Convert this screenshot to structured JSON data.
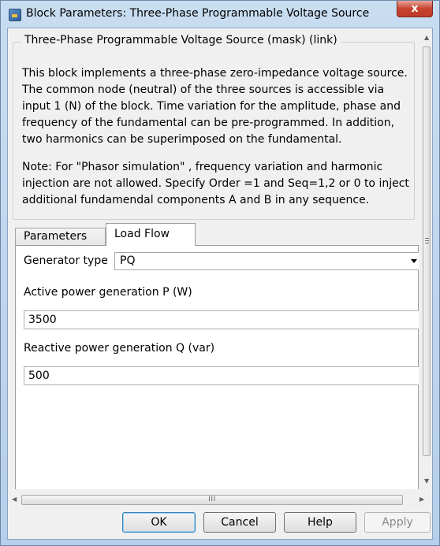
{
  "window": {
    "title": "Block Parameters: Three-Phase Programmable Voltage Source",
    "close_label": "x"
  },
  "mask": {
    "title": "Three-Phase Programmable Voltage Source (mask) (link)",
    "description": "This block implements a three-phase zero-impedance voltage source.\nThe common node (neutral) of the three sources is accessible via\ninput 1 (N) of the block. Time variation for the amplitude, phase and\nfrequency of the fundamental can be pre-programmed. In addition,\ntwo harmonics can be superimposed on the fundamental.",
    "note": "Note: For  \"Phasor simulation\" , frequency variation and harmonic injection are not allowed.  Specify  Order =1 and Seq=1,2 or 0 to inject additional fundamendal components A and B in  any sequence."
  },
  "tabs": [
    {
      "label": "Parameters",
      "active": false
    },
    {
      "label": "Load Flow",
      "active": true
    }
  ],
  "load_flow": {
    "generator_type_label": "Generator type",
    "generator_type_value": "PQ",
    "active_power_label": "Active power generation P (W)",
    "active_power_value": "3500",
    "reactive_power_label": "Reactive power generation Q (var)",
    "reactive_power_value": "500"
  },
  "scrollbar": {
    "thumb_grip": "III"
  },
  "buttons": {
    "ok": "OK",
    "cancel": "Cancel",
    "help": "Help",
    "apply": "Apply"
  }
}
